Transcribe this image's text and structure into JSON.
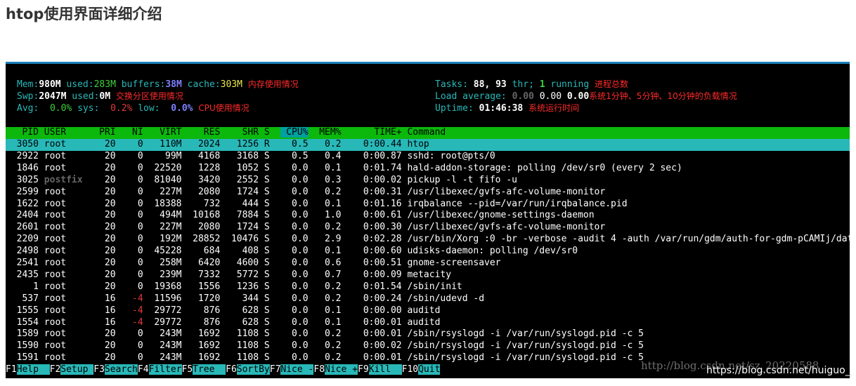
{
  "page": {
    "title": "htop使用界面详细介绍"
  },
  "meters": {
    "mem": {
      "label": "Mem:",
      "total": "980M",
      "used_label": " used:",
      "used": "283M",
      "buffers_label": " buffers:",
      "buffers": "38M",
      "cache_label": " cache:",
      "cache": "303M",
      "annotation": "内存使用情况"
    },
    "swp": {
      "label": "Swp:",
      "total": "2047M",
      "used_label": " used:",
      "used": "0M",
      "annotation": "交换分区使用情况"
    },
    "avg": {
      "label": "Avg:",
      "user": "0.0%",
      "sys_label": "sys:",
      "sys": "0.2%",
      "low_label": "low:",
      "low": "0.0%",
      "annotation": "CPU使用情况"
    },
    "tasks": {
      "label": "Tasks:",
      "tasks": "88,",
      "threads": "93",
      "thr_label": "thr;",
      "running": "1",
      "running_label": "running",
      "annotation": "进程总数"
    },
    "load": {
      "label": "Load average:",
      "l1": "0.00",
      "l5": "0.00",
      "l15": "0.00",
      "annotation": "系统1分钟、5分钟、10分钟的负载情况"
    },
    "uptime": {
      "label": "Uptime:",
      "value": "01:46:38",
      "annotation": "系统运行时间"
    }
  },
  "table": {
    "columns": [
      "PID",
      "USER",
      "PRI",
      "NI",
      "VIRT",
      "RES",
      "SHR",
      "S",
      "CPU%",
      "MEM%",
      "TIME+",
      "Command"
    ],
    "sort_column": "CPU%",
    "rows": [
      {
        "pid": "3050",
        "user": "root",
        "pri": "20",
        "ni": "0",
        "virt": "110M",
        "res": "2024",
        "shr": "1256",
        "s": "R",
        "cpu": "0.5",
        "mem": "0.2",
        "time": "0:00.44",
        "cmd": "htop",
        "selected": true
      },
      {
        "pid": "2922",
        "user": "root",
        "pri": "20",
        "ni": "0",
        "virt": "99M",
        "res": "4168",
        "shr": "3168",
        "s": "S",
        "cpu": "0.5",
        "mem": "0.4",
        "time": "0:00.87",
        "cmd": "sshd: root@pts/0"
      },
      {
        "pid": "1846",
        "user": "root",
        "pri": "20",
        "ni": "0",
        "virt": "22520",
        "res": "1228",
        "shr": "1052",
        "s": "S",
        "cpu": "0.0",
        "mem": "0.1",
        "time": "0:01.74",
        "cmd": "hald-addon-storage: polling /dev/sr0 (every 2 sec)"
      },
      {
        "pid": "3025",
        "user": "postfix",
        "pri": "20",
        "ni": "0",
        "virt": "81040",
        "res": "3420",
        "shr": "2552",
        "s": "S",
        "cpu": "0.0",
        "mem": "0.3",
        "time": "0:00.02",
        "cmd": "pickup -l -t fifo -u"
      },
      {
        "pid": "2599",
        "user": "root",
        "pri": "20",
        "ni": "0",
        "virt": "227M",
        "res": "2080",
        "shr": "1724",
        "s": "S",
        "cpu": "0.0",
        "mem": "0.2",
        "time": "0:00.31",
        "cmd": "/usr/libexec/gvfs-afc-volume-monitor"
      },
      {
        "pid": "1622",
        "user": "root",
        "pri": "20",
        "ni": "0",
        "virt": "18388",
        "res": "732",
        "shr": "444",
        "s": "S",
        "cpu": "0.0",
        "mem": "0.1",
        "time": "0:01.16",
        "cmd": "irqbalance --pid=/var/run/irqbalance.pid"
      },
      {
        "pid": "2404",
        "user": "root",
        "pri": "20",
        "ni": "0",
        "virt": "494M",
        "res": "10168",
        "shr": "7884",
        "s": "S",
        "cpu": "0.0",
        "mem": "1.0",
        "time": "0:00.61",
        "cmd": "/usr/libexec/gnome-settings-daemon"
      },
      {
        "pid": "2601",
        "user": "root",
        "pri": "20",
        "ni": "0",
        "virt": "227M",
        "res": "2080",
        "shr": "1724",
        "s": "S",
        "cpu": "0.0",
        "mem": "0.2",
        "time": "0:00.30",
        "cmd": "/usr/libexec/gvfs-afc-volume-monitor"
      },
      {
        "pid": "2209",
        "user": "root",
        "pri": "20",
        "ni": "0",
        "virt": "192M",
        "res": "28852",
        "shr": "10476",
        "s": "S",
        "cpu": "0.0",
        "mem": "2.9",
        "time": "0:02.28",
        "cmd": "/usr/bin/Xorg :0 -br -verbose -audit 4 -auth /var/run/gdm/auth-for-gdm-pCAMIj/datab"
      },
      {
        "pid": "2498",
        "user": "root",
        "pri": "20",
        "ni": "0",
        "virt": "45228",
        "res": "684",
        "shr": "408",
        "s": "S",
        "cpu": "0.0",
        "mem": "0.1",
        "time": "0:00.60",
        "cmd": "udisks-daemon: polling /dev/sr0"
      },
      {
        "pid": "2541",
        "user": "root",
        "pri": "20",
        "ni": "0",
        "virt": "258M",
        "res": "6420",
        "shr": "4600",
        "s": "S",
        "cpu": "0.0",
        "mem": "0.6",
        "time": "0:00.51",
        "cmd": "gnome-screensaver"
      },
      {
        "pid": "2435",
        "user": "root",
        "pri": "20",
        "ni": "0",
        "virt": "239M",
        "res": "7332",
        "shr": "5772",
        "s": "S",
        "cpu": "0.0",
        "mem": "0.7",
        "time": "0:00.09",
        "cmd": "metacity"
      },
      {
        "pid": "1",
        "user": "root",
        "pri": "20",
        "ni": "0",
        "virt": "19368",
        "res": "1556",
        "shr": "1236",
        "s": "S",
        "cpu": "0.0",
        "mem": "0.2",
        "time": "0:01.54",
        "cmd": "/sbin/init"
      },
      {
        "pid": "537",
        "user": "root",
        "pri": "16",
        "ni": "-4",
        "virt": "11596",
        "res": "1720",
        "shr": "344",
        "s": "S",
        "cpu": "0.0",
        "mem": "0.2",
        "time": "0:00.24",
        "cmd": "/sbin/udevd -d"
      },
      {
        "pid": "1555",
        "user": "root",
        "pri": "16",
        "ni": "-4",
        "virt": "29772",
        "res": "876",
        "shr": "628",
        "s": "S",
        "cpu": "0.0",
        "mem": "0.1",
        "time": "0:00.00",
        "cmd": "auditd"
      },
      {
        "pid": "1554",
        "user": "root",
        "pri": "16",
        "ni": "-4",
        "virt": "29772",
        "res": "876",
        "shr": "628",
        "s": "S",
        "cpu": "0.0",
        "mem": "0.1",
        "time": "0:00.01",
        "cmd": "auditd"
      },
      {
        "pid": "1589",
        "user": "root",
        "pri": "20",
        "ni": "0",
        "virt": "243M",
        "res": "1692",
        "shr": "1108",
        "s": "S",
        "cpu": "0.0",
        "mem": "0.2",
        "time": "0:00.01",
        "cmd": "/sbin/rsyslogd -i /var/run/syslogd.pid -c 5"
      },
      {
        "pid": "1590",
        "user": "root",
        "pri": "20",
        "ni": "0",
        "virt": "243M",
        "res": "1692",
        "shr": "1108",
        "s": "S",
        "cpu": "0.0",
        "mem": "0.2",
        "time": "0:00.02",
        "cmd": "/sbin/rsyslogd -i /var/run/syslogd.pid -c 5"
      },
      {
        "pid": "1591",
        "user": "root",
        "pri": "20",
        "ni": "0",
        "virt": "243M",
        "res": "1692",
        "shr": "1108",
        "s": "S",
        "cpu": "0.0",
        "mem": "0.2",
        "time": "0:00.01",
        "cmd": "/sbin/rsyslogd -i /var/run/syslogd.pid -c 5"
      }
    ]
  },
  "function_keys": [
    {
      "key": "F1",
      "label": "Help  "
    },
    {
      "key": "F2",
      "label": "Setup "
    },
    {
      "key": "F3",
      "label": "Search"
    },
    {
      "key": "F4",
      "label": "Filter"
    },
    {
      "key": "F5",
      "label": "Tree  "
    },
    {
      "key": "F6",
      "label": "SortBy"
    },
    {
      "key": "F7",
      "label": "Nice -"
    },
    {
      "key": "F8",
      "label": "Nice +"
    },
    {
      "key": "F9",
      "label": "Kill  "
    },
    {
      "key": "F10",
      "label": "Quit"
    }
  ],
  "watermark": {
    "text": "https://blog.csdn.net/huiguo_",
    "ghost_text": "http://blog.csdn.net/sz_20220588"
  },
  "colors": {
    "terminal_bg": "#000000",
    "header_bg": "#0bb80b",
    "selection_bg": "#29b8b8",
    "cyan": "#29b8b8",
    "annotation": "#ff2a2a"
  }
}
